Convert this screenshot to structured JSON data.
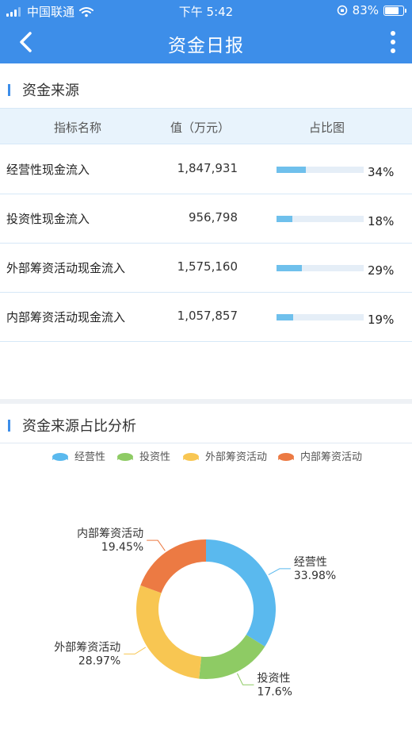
{
  "status_bar": {
    "carrier": "中国联通",
    "time": "下午 5:42",
    "battery": "83%",
    "battery_level": 0.83
  },
  "header": {
    "title": "资金日报"
  },
  "sources": {
    "title": "资金来源",
    "columns": [
      "指标名称",
      "值（万元）",
      "占比图"
    ],
    "rows": [
      {
        "name": "经营性现金流入",
        "value": "1,847,931",
        "percent_label": "34%",
        "fraction": 0.34
      },
      {
        "name": "投资性现金流入",
        "value": "956,798",
        "percent_label": "18%",
        "fraction": 0.18
      },
      {
        "name": "外部筹资活动现金流入",
        "value": "1,575,160",
        "percent_label": "29%",
        "fraction": 0.29
      },
      {
        "name": "内部筹资活动现金流入",
        "value": "1,057,857",
        "percent_label": "19%",
        "fraction": 0.19
      }
    ]
  },
  "analysis": {
    "title": "资金来源占比分析"
  },
  "colors": {
    "accent": "#3d8ee9",
    "bar_fill": "#6fc0ec",
    "bar_track": "#e5eef7"
  },
  "chart_data": {
    "type": "pie",
    "donut": true,
    "legend_position": "top",
    "categories": [
      "经营性",
      "投资性",
      "外部筹资活动",
      "内部筹资活动"
    ],
    "values": [
      33.98,
      17.6,
      28.97,
      19.45
    ],
    "labels": [
      "33.98%",
      "17.6%",
      "28.97%",
      "19.45%"
    ],
    "colors": [
      "#5ab9ee",
      "#8ecb64",
      "#f8c652",
      "#ec7a43"
    ]
  }
}
